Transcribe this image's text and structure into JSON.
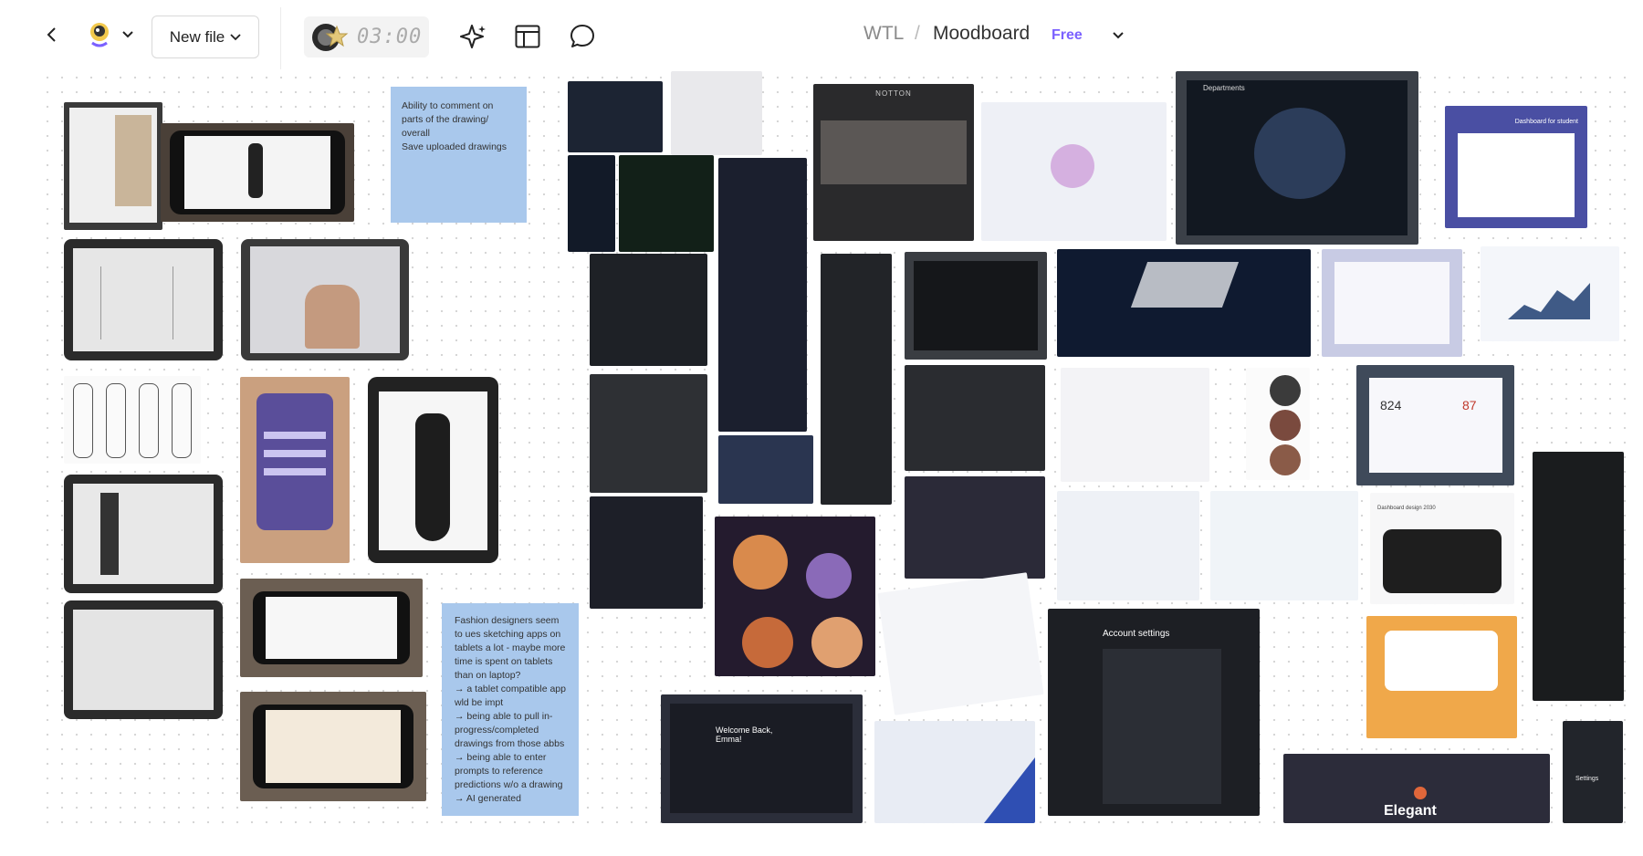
{
  "toolbar": {
    "new_file_label": "New file",
    "timer": "03:00",
    "breadcrumb_team": "WTL",
    "breadcrumb_separator": "/",
    "breadcrumb_file": "Moodboard",
    "plan_badge": "Free"
  },
  "notes": {
    "note1": "Ability to comment on\nparts of the drawing/\noverall\nSave uploaded drawings",
    "note2": "Fashion designers seem\nto ues sketching apps on\ntablets a lot - maybe more\ntime is spent on tablets\nthan on laptop?\n→ a tablet compatible app\nwld be impt\n→ being able to pull in-\nprogress/completed\ndrawings from those abbs\n→ being able to enter\nprompts to reference\npredictions w/o a drawing\n→ AI generated"
  },
  "thumbnails": {
    "notton": "NOTTON",
    "departments": "Departments",
    "dashboard_student": "Dashboard for student",
    "account_settings": "Account settings",
    "welcome": "Welcome Back,\nEmma!",
    "elegant": "Elegant",
    "settings": "Settings",
    "stat_824": "824",
    "stat_87": "87",
    "dashboard_design": "Dashboard design 2030"
  },
  "colors": {
    "accent": "#7b61ff",
    "note": "#a9c8ec",
    "orange_card": "#f0a84a"
  },
  "icons": [
    "back-icon",
    "avatar-icon",
    "chevron-down-icon",
    "sparkle-icon",
    "layout-icon",
    "comment-icon"
  ]
}
